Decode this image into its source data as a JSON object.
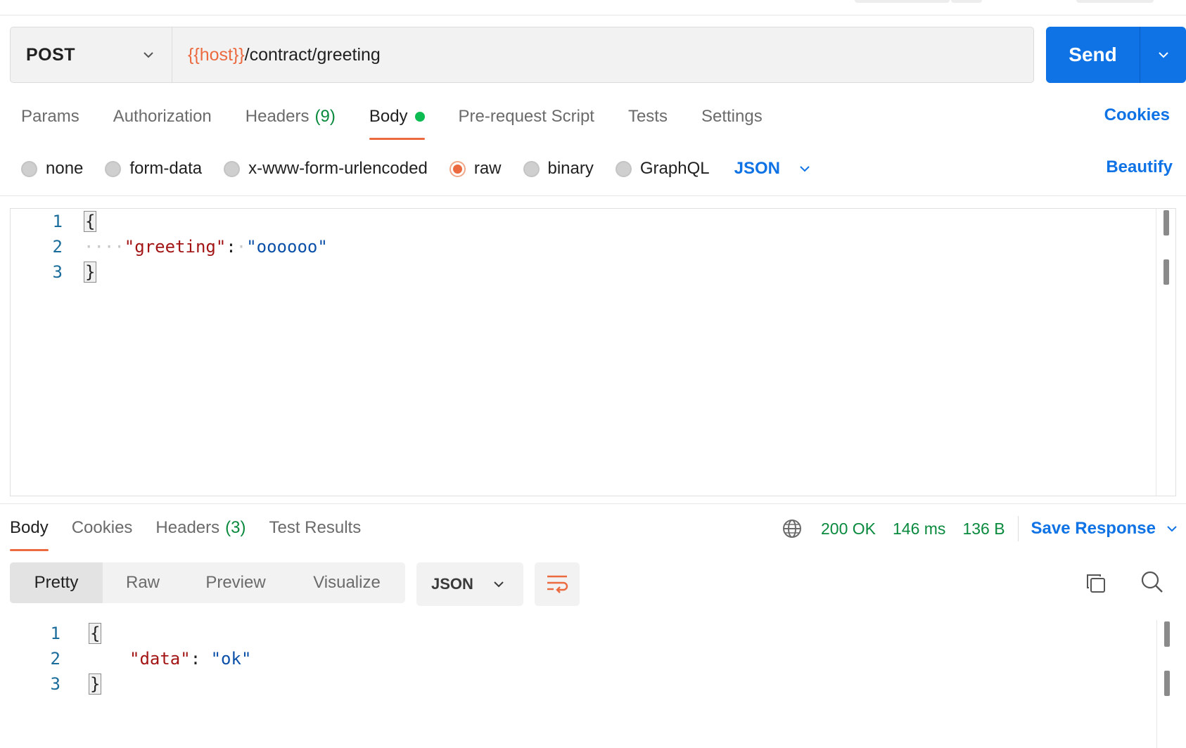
{
  "request": {
    "method": "POST",
    "url_variable": "{{host}}",
    "url_path": "/contract/greeting",
    "send_label": "Send"
  },
  "request_tabs": [
    {
      "label": "Params"
    },
    {
      "label": "Authorization"
    },
    {
      "label": "Headers",
      "count": "(9)"
    },
    {
      "label": "Body",
      "active": true,
      "indicator": "green-dot"
    },
    {
      "label": "Pre-request Script"
    },
    {
      "label": "Tests"
    },
    {
      "label": "Settings"
    }
  ],
  "cookies_link": "Cookies",
  "body_types": [
    {
      "label": "none",
      "selected": false
    },
    {
      "label": "form-data",
      "selected": false
    },
    {
      "label": "x-www-form-urlencoded",
      "selected": false
    },
    {
      "label": "raw",
      "selected": true
    },
    {
      "label": "binary",
      "selected": false
    },
    {
      "label": "GraphQL",
      "selected": false
    }
  ],
  "body_format": "JSON",
  "beautify_label": "Beautify",
  "request_body": {
    "lines": [
      {
        "number": "1",
        "text": "{"
      },
      {
        "number": "2",
        "indent": "····",
        "key": "\"greeting\"",
        "colon": ":",
        "space": "·",
        "value": "\"oooooo\""
      },
      {
        "number": "3",
        "text": "}"
      }
    ]
  },
  "response_tabs": [
    {
      "label": "Body",
      "active": true
    },
    {
      "label": "Cookies"
    },
    {
      "label": "Headers",
      "count": "(3)"
    },
    {
      "label": "Test Results"
    }
  ],
  "response_status": {
    "code": "200 OK",
    "time": "146 ms",
    "size": "136 B",
    "save_label": "Save Response"
  },
  "response_views": [
    {
      "label": "Pretty",
      "active": true
    },
    {
      "label": "Raw"
    },
    {
      "label": "Preview"
    },
    {
      "label": "Visualize"
    }
  ],
  "response_format": "JSON",
  "response_body": {
    "lines": [
      {
        "number": "1",
        "text": "{"
      },
      {
        "number": "2",
        "key": "\"data\"",
        "colon": ":",
        "value": "\"ok\""
      },
      {
        "number": "3",
        "text": "}"
      }
    ]
  },
  "icons": {
    "method_dropdown": "chevron-down-icon",
    "send_dropdown": "chevron-down-icon",
    "globe": "globe-icon",
    "wrap": "wrap-lines-icon",
    "copy": "copy-icon",
    "search": "search-icon"
  },
  "colors": {
    "accent_blue": "#0f72e5",
    "active_tab_underline": "#eb6a3f",
    "url_variable": "#eb6a3f",
    "status_green": "#0a8a3e",
    "body_dot": "#0cbb52",
    "json_key": "#a31515",
    "json_string": "#0b50a8"
  }
}
